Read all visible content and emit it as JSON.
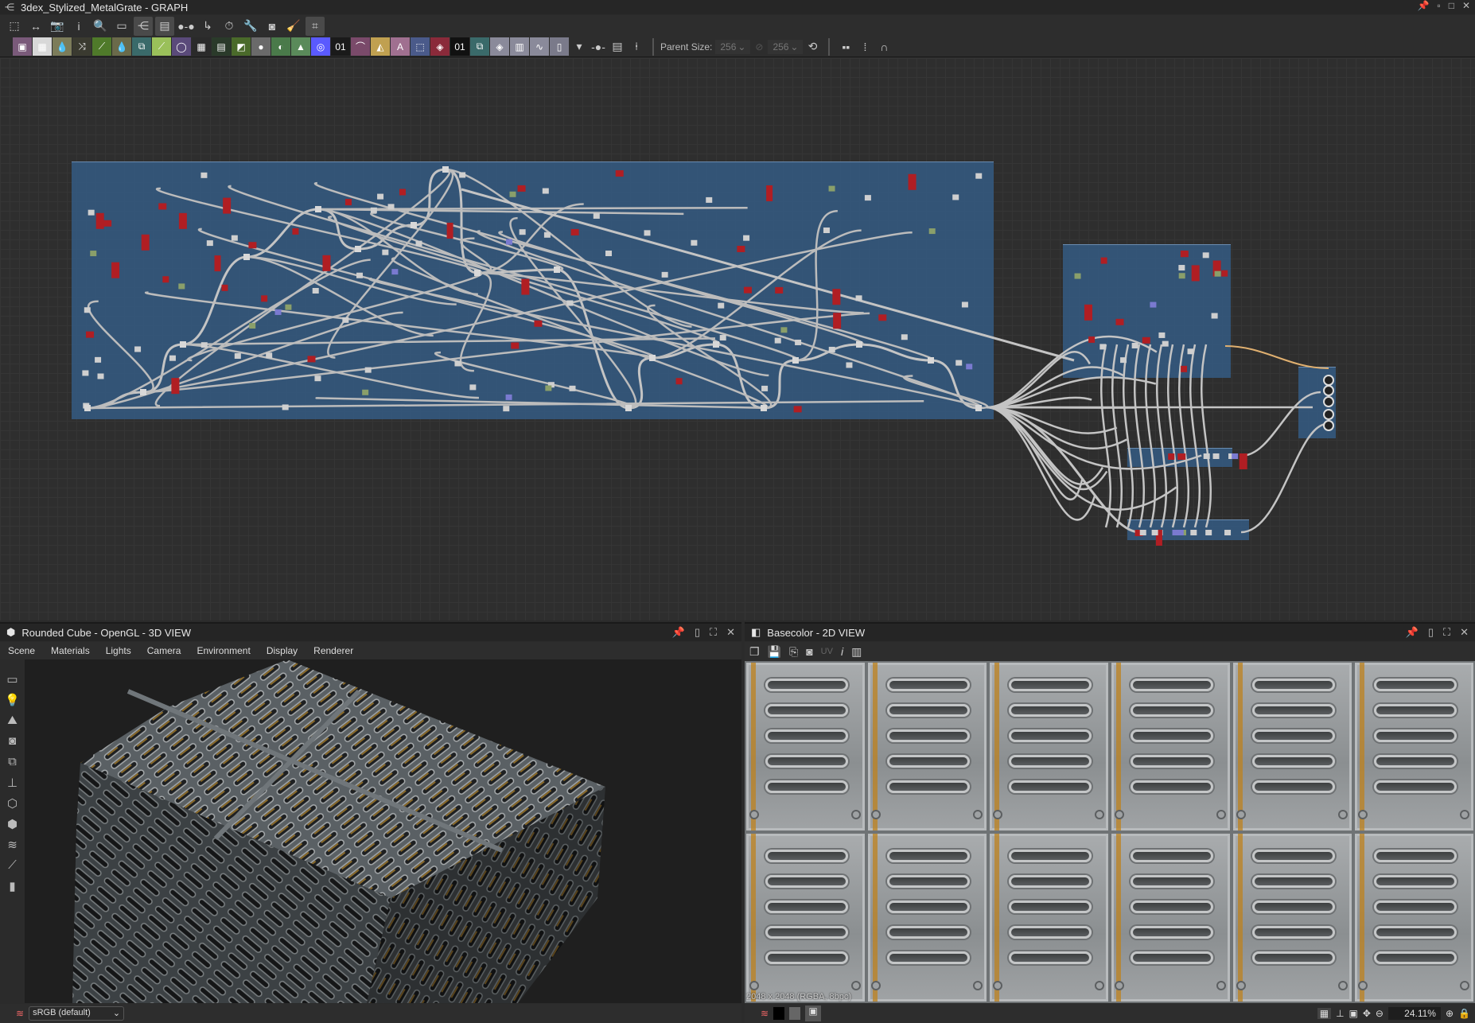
{
  "window": {
    "title": "3dex_Stylized_MetalGrate - GRAPH",
    "controls": [
      "pin",
      "restore",
      "maximize",
      "close"
    ]
  },
  "toolbar_main": {
    "icons": [
      "frame-all-icon",
      "fit-1-1-icon",
      "screenshot-icon",
      "info-icon",
      "search-icon",
      "node-link-icon",
      "hierarchy-icon",
      "layers-icon",
      "connect-icon",
      "route-icon",
      "timer-icon",
      "tools-icon",
      "preview-icon",
      "cleanup-icon",
      "grid-snap-icon"
    ]
  },
  "toolbar_nodes": {
    "items": [
      {
        "name": "bitmap",
        "color": "#7a5a7a",
        "glyph": "▣"
      },
      {
        "name": "uniform-color",
        "color": "#d8d8d8",
        "glyph": "▦"
      },
      {
        "name": "blur",
        "color": "#7c7c5a",
        "glyph": "💧"
      },
      {
        "name": "shuffle",
        "color": "#3a3a30",
        "glyph": "⤨"
      },
      {
        "name": "curve",
        "color": "#4f7a2a",
        "glyph": "⟋"
      },
      {
        "name": "directional-warp",
        "color": "#6a6a4a",
        "glyph": "💧"
      },
      {
        "name": "warp",
        "color": "#3a6a6a",
        "glyph": "⧉"
      },
      {
        "name": "gradient-map",
        "color": "#9ac05a",
        "glyph": "⟋"
      },
      {
        "name": "circle",
        "color": "#5a4a7a",
        "glyph": "◯"
      },
      {
        "name": "tile",
        "color": "#2a2a2a",
        "glyph": "▦"
      },
      {
        "name": "blend",
        "color": "#2a3a2a",
        "glyph": "▤"
      },
      {
        "name": "levels-gradient",
        "color": "#4a6a2a",
        "glyph": "◩"
      },
      {
        "name": "transform",
        "color": "#6a6a6a",
        "glyph": "●"
      },
      {
        "name": "normal",
        "color": "#4a7a4a",
        "glyph": "◐"
      },
      {
        "name": "histogram",
        "color": "#5a8a5a",
        "glyph": "▲"
      },
      {
        "name": "hsl",
        "color": "#5a5aff",
        "glyph": "◎"
      },
      {
        "name": "noise",
        "color": "#1a1a1a",
        "glyph": "01"
      },
      {
        "name": "spline",
        "color": "#7a4a6a",
        "glyph": "⌒"
      },
      {
        "name": "mirror",
        "color": "#c0a050",
        "glyph": "◭"
      },
      {
        "name": "text",
        "color": "#a07090",
        "glyph": "A"
      },
      {
        "name": "selection",
        "color": "#4a5a8a",
        "glyph": "⬚"
      },
      {
        "name": "fill",
        "color": "#8a2a3a",
        "glyph": "◈"
      },
      {
        "name": "fx-map",
        "color": "#111111",
        "glyph": "01"
      },
      {
        "name": "pixel-processor",
        "color": "#3a6a6a",
        "glyph": "⧉"
      },
      {
        "name": "input-value",
        "color": "#8a8a9a",
        "glyph": "◈"
      },
      {
        "name": "input-gradient",
        "color": "#8a8a9a",
        "glyph": "▥"
      },
      {
        "name": "input-graph",
        "color": "#8a8a9a",
        "glyph": "∿"
      },
      {
        "name": "output",
        "color": "#7a7a8a",
        "glyph": "▯"
      }
    ],
    "extra_icons": [
      "comment-icon",
      "dot-icon",
      "frame-icon",
      "pin-icon"
    ],
    "parent_size_label": "Parent Size:",
    "parent_size_w": "256",
    "parent_size_h": "256",
    "align_icons": [
      "align-horizontal-icon",
      "align-vertical-icon",
      "snap-icon"
    ]
  },
  "view3d": {
    "title": "Rounded Cube - OpenGL - 3D VIEW",
    "menu": [
      "Scene",
      "Materials",
      "Lights",
      "Camera",
      "Environment",
      "Display",
      "Renderer"
    ],
    "colorspace": "sRGB (default)"
  },
  "view2d": {
    "title": "Basecolor - 2D VIEW",
    "uv_label": "UV",
    "resolution": "2048 x 2048 (RGBA, 8bpc)",
    "zoom": "24.11%"
  },
  "colors": {
    "frame": "#345a82",
    "node_red": "#b01e23",
    "node_gray": "#c8c8c8",
    "link": "#c8c8c8",
    "link_orange": "#e0a040",
    "rust": "#be821e"
  }
}
